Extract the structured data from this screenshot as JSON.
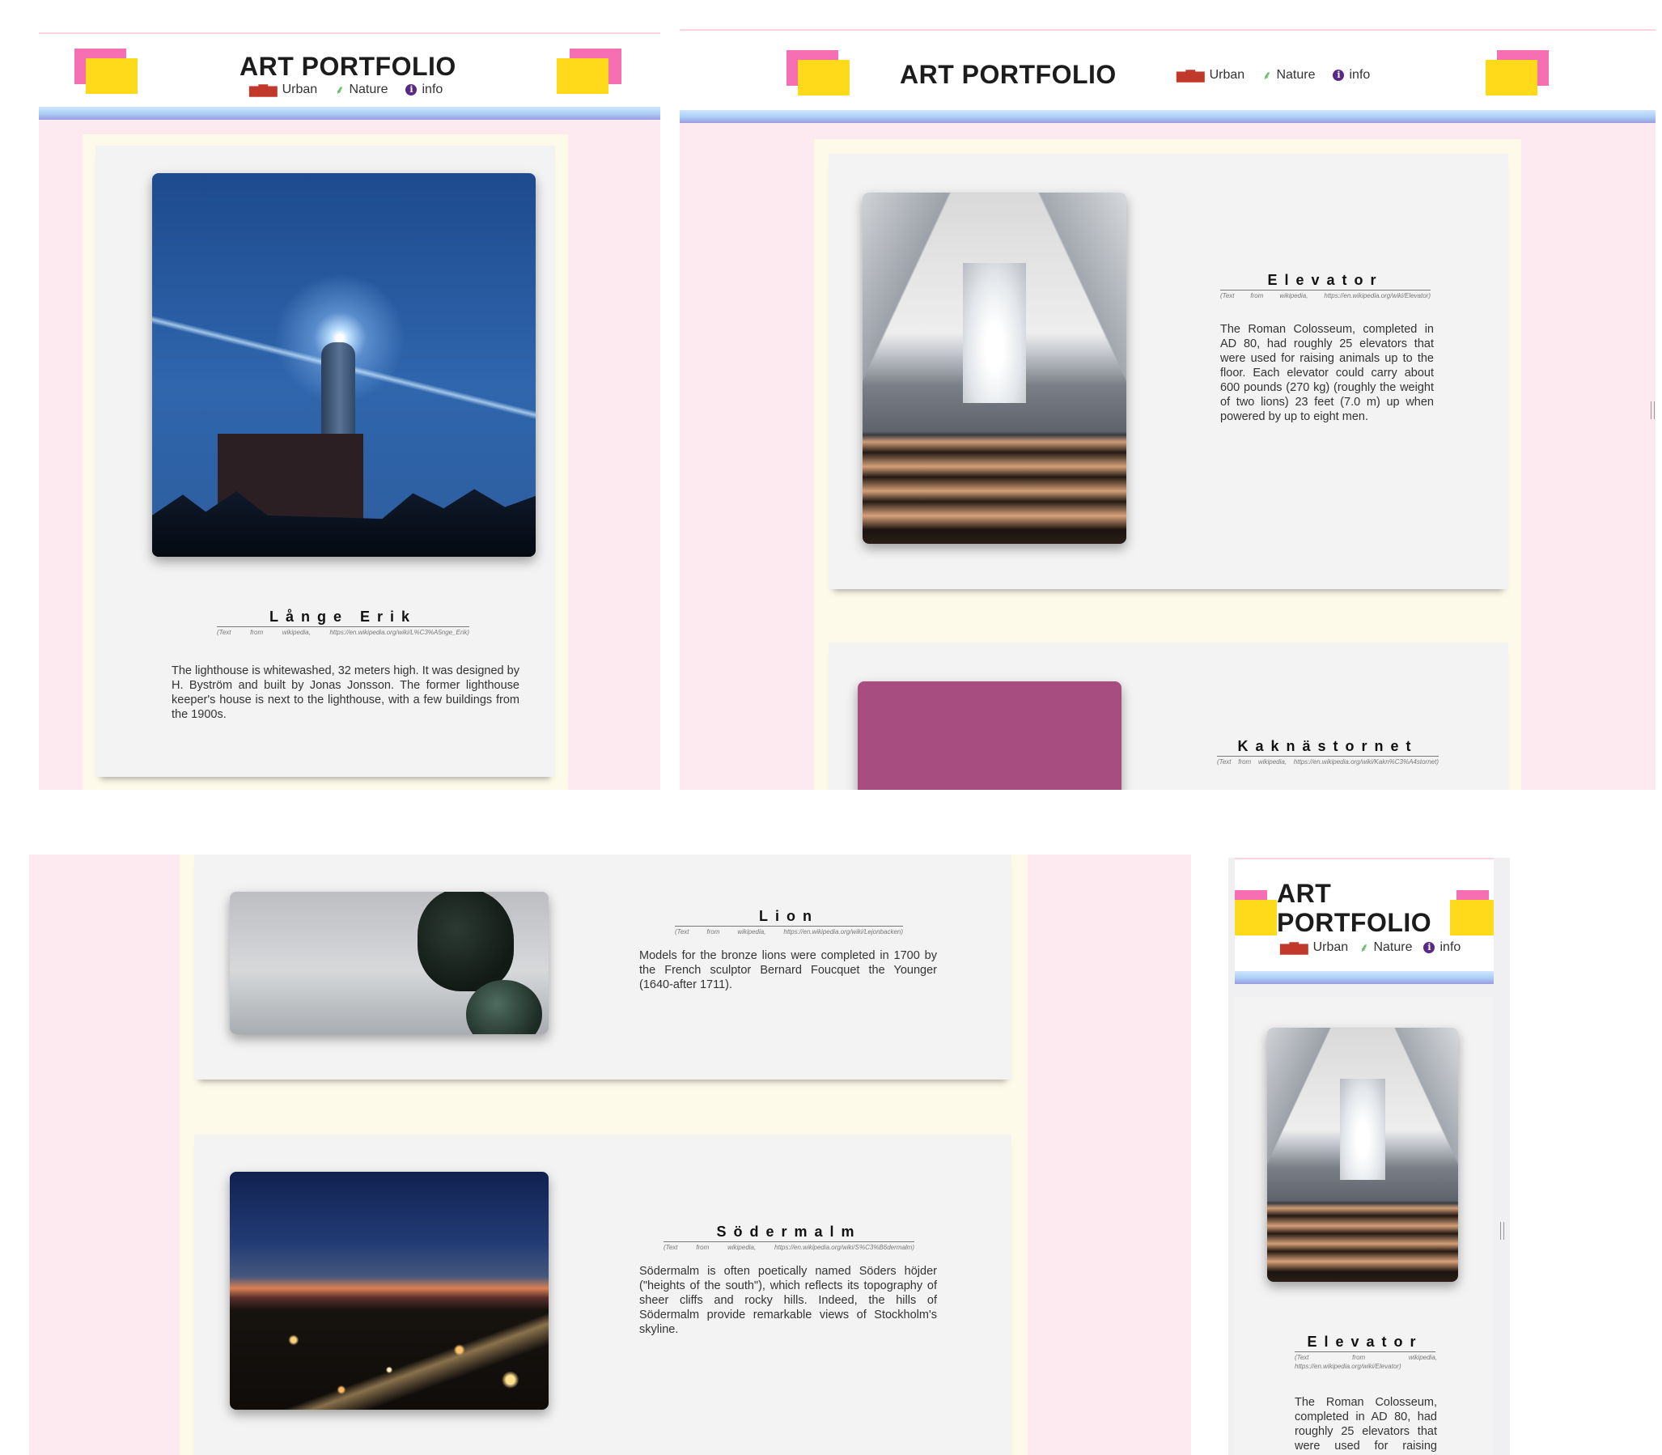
{
  "site": {
    "title": "ART PORTFOLIO",
    "nav": [
      {
        "label": "Urban",
        "icon": "city-icon"
      },
      {
        "label": "Nature",
        "icon": "plant-icon"
      },
      {
        "label": "info",
        "icon": "info-icon"
      }
    ]
  },
  "artworks": {
    "lange_erik": {
      "title": "Långe Erik",
      "credit": "(Text from wikipedia, https://en.wikipedia.org/wiki/L%C3%A5nge_Erik)",
      "description": "The lighthouse is whitewashed, 32 meters high. It was designed by H. Byström and built by Jonas Jonsson. The former lighthouse keeper's house is next to the lighthouse, with a few buildings from the 1900s."
    },
    "elevator": {
      "title": "Elevator",
      "credit": "(Text from wikipedia, https://en.wikipedia.org/wiki/Elevator)",
      "description": "The Roman Colosseum, completed in AD 80, had roughly 25 elevators that were used for raising animals up to the floor. Each elevator could carry about 600 pounds (270 kg) (roughly the weight of two lions) 23 feet (7.0 m) up when powered by up to eight men.",
      "description_partial": "The Roman Colosseum, completed in AD 80, had roughly 25 elevators that were used for raising animals up to the floor."
    },
    "kaknastornet": {
      "title": "Kaknästornet",
      "credit": "(Text from wikipedia, https://en.wikipedia.org/wiki/Kakn%C3%A4stornet)"
    },
    "lion": {
      "title": "Lion",
      "credit": "(Text from wikipedia, https://en.wikipedia.org/wiki/Lejonbacken)",
      "description": "Models for the bronze lions were completed in 1700 by the French sculptor Bernard Foucquet the Younger (1640-after 1711)."
    },
    "sodermalm": {
      "title": "Södermalm",
      "credit": "(Text from wikipedia, https://en.wikipedia.org/wiki/S%C3%B6dermalm)",
      "description": "Södermalm is often poetically named Söders höjder (\"heights of the south\"), which reflects its topography of sheer cliffs and rocky hills. Indeed, the hills of Södermalm provide remarkable views of Stockholm's skyline."
    }
  },
  "colors": {
    "page_background": "#fde9f0",
    "column_background": "#fdfaea",
    "card_background": "#f3f3f3",
    "accent_pink": "#f76fb3",
    "accent_yellow": "#ffda1a",
    "header_band": "#a9cdf5"
  }
}
